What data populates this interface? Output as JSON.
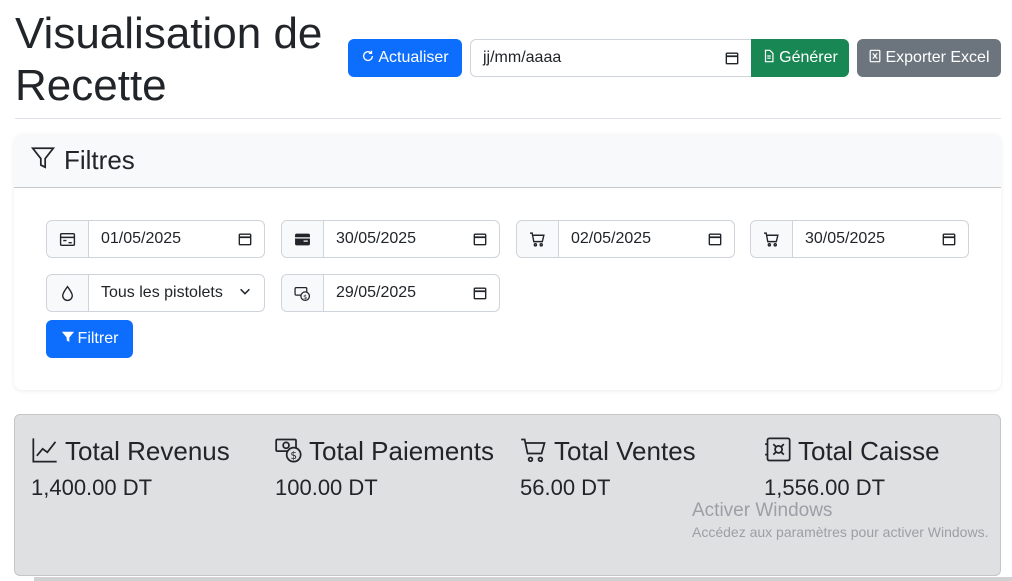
{
  "header": {
    "title": "Visualisation de Recette",
    "refresh_label": "Actualiser",
    "date_placeholder": "jj/mm/aaaa",
    "generate_label": "Générer",
    "export_label": "Exporter Excel"
  },
  "filters": {
    "title": "Filtres",
    "date1": "01/05/2025",
    "date2": "30/05/2025",
    "date3": "02/05/2025",
    "date4": "30/05/2025",
    "pistolet": "Tous les pistolets",
    "date5": "29/05/2025",
    "filter_label": "Filtrer"
  },
  "stats": {
    "revenus": {
      "label": "Total Revenus",
      "value": "1,400.00 DT"
    },
    "paiements": {
      "label": "Total Paiements",
      "value": "100.00 DT"
    },
    "ventes": {
      "label": "Total Ventes",
      "value": "56.00 DT"
    },
    "caisse": {
      "label": "Total Caisse",
      "value": "1,556.00 DT"
    }
  },
  "watermark": {
    "line1": "Activer Windows",
    "line2": "Accédez aux paramètres pour activer Windows."
  },
  "colors": {
    "primary": "#0d6efd",
    "success": "#198754",
    "secondary": "#6c757d",
    "stats_bg": "#dfe0e1"
  }
}
